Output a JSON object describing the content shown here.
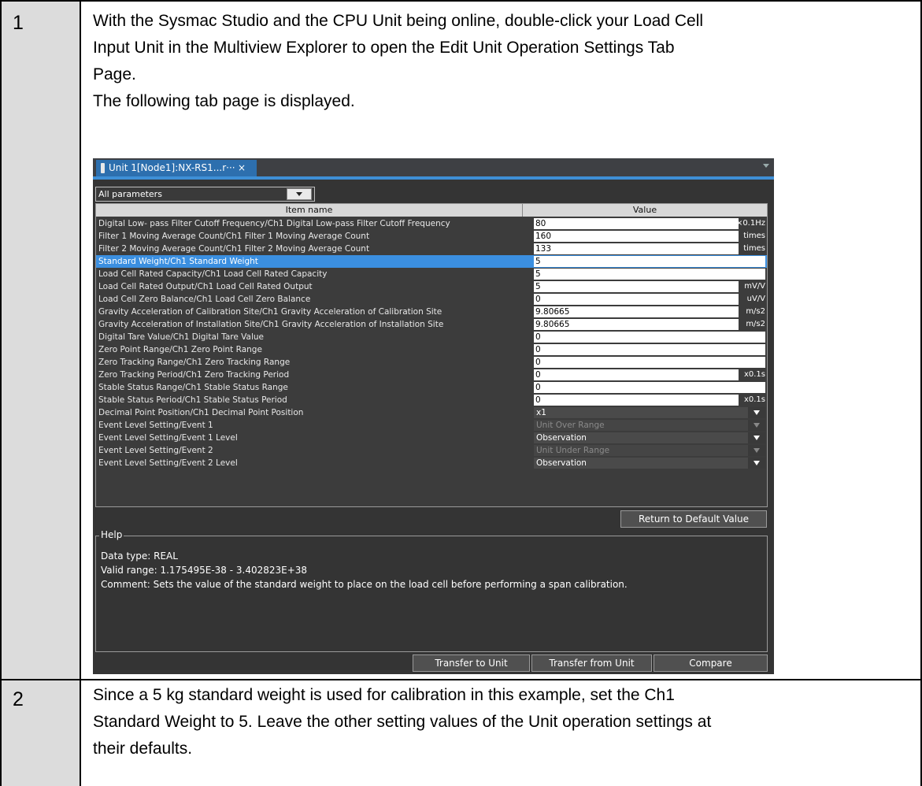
{
  "steps": [
    {
      "number": "1",
      "text_lines": [
        "With the Sysmac Studio and the CPU Unit being online, double-click your Load Cell",
        "Input Unit in the Multiview Explorer to open the Edit Unit Operation Settings Tab",
        "Page.",
        "The following tab page is displayed."
      ]
    },
    {
      "number": "2",
      "text_lines": [
        "Since a 5 kg standard weight is used for calibration in this example, set the Ch1",
        "Standard Weight to 5. Leave the other setting values of the Unit operation settings at",
        "their defaults."
      ]
    }
  ],
  "window": {
    "tab_label": "Unit 1[Node1]:NX-RS1...r···",
    "tab_close": "×",
    "filter": "All parameters",
    "columns": {
      "item": "Item name",
      "value": "Value"
    },
    "rows": [
      {
        "name": "Digital Low- pass Filter Cutoff Frequency/Ch1 Digital Low-pass Filter Cutoff Frequency",
        "value": "80",
        "unit": "×0.1Hz",
        "kind": "input"
      },
      {
        "name": "Filter 1 Moving Average Count/Ch1 Filter 1 Moving Average Count",
        "value": "160",
        "unit": "times",
        "kind": "input"
      },
      {
        "name": "Filter 2 Moving Average Count/Ch1 Filter 2 Moving Average Count",
        "value": "133",
        "unit": "times",
        "kind": "input"
      },
      {
        "name": "Standard Weight/Ch1 Standard Weight",
        "value": "5",
        "unit": "",
        "kind": "input",
        "selected": true
      },
      {
        "name": "Load Cell Rated Capacity/Ch1 Load Cell Rated Capacity",
        "value": "5",
        "unit": "",
        "kind": "input"
      },
      {
        "name": "Load Cell Rated Output/Ch1 Load Cell Rated Output",
        "value": "5",
        "unit": "mV/V",
        "kind": "input"
      },
      {
        "name": "Load Cell Zero Balance/Ch1 Load Cell Zero Balance",
        "value": "0",
        "unit": "uV/V",
        "kind": "input"
      },
      {
        "name": "Gravity Acceleration of Calibration Site/Ch1 Gravity Acceleration of Calibration Site",
        "value": "9.80665",
        "unit": "m/s2",
        "kind": "input"
      },
      {
        "name": "Gravity Acceleration of Installation Site/Ch1 Gravity Acceleration of Installation Site",
        "value": "9.80665",
        "unit": "m/s2",
        "kind": "input"
      },
      {
        "name": "Digital Tare Value/Ch1 Digital Tare Value",
        "value": "0",
        "unit": "",
        "kind": "input"
      },
      {
        "name": "Zero Point Range/Ch1 Zero Point Range",
        "value": "0",
        "unit": "",
        "kind": "input"
      },
      {
        "name": "Zero Tracking Range/Ch1 Zero Tracking Range",
        "value": "0",
        "unit": "",
        "kind": "input"
      },
      {
        "name": "Zero Tracking Period/Ch1 Zero Tracking Period",
        "value": "0",
        "unit": "x0.1s",
        "kind": "input"
      },
      {
        "name": "Stable Status Range/Ch1 Stable Status Range",
        "value": "0",
        "unit": "",
        "kind": "input"
      },
      {
        "name": "Stable Status Period/Ch1 Stable Status Period",
        "value": "0",
        "unit": "x0.1s",
        "kind": "input"
      },
      {
        "name": "Decimal Point Position/Ch1 Decimal Point Position",
        "value": "x1",
        "unit": "",
        "kind": "dropdown"
      },
      {
        "name": "Event Level Setting/Event 1",
        "value": "Unit Over Range",
        "unit": "",
        "kind": "dropdown-disabled"
      },
      {
        "name": "Event Level Setting/Event 1 Level",
        "value": "Observation",
        "unit": "",
        "kind": "dropdown"
      },
      {
        "name": "Event Level Setting/Event 2",
        "value": "Unit Under Range",
        "unit": "",
        "kind": "dropdown-disabled"
      },
      {
        "name": "Event Level Setting/Event 2 Level",
        "value": "Observation",
        "unit": "",
        "kind": "dropdown"
      }
    ],
    "return_default": "Return to Default Value",
    "help": {
      "title": "Help",
      "lines": [
        "Data type: REAL",
        "Valid range: 1.175495E-38 - 3.402823E+38",
        "Comment: Sets the value of the standard weight to place on the load cell before performing a span calibration."
      ]
    },
    "buttons": {
      "transfer_to": "Transfer to Unit",
      "transfer_from": "Transfer from Unit",
      "compare": "Compare"
    }
  }
}
